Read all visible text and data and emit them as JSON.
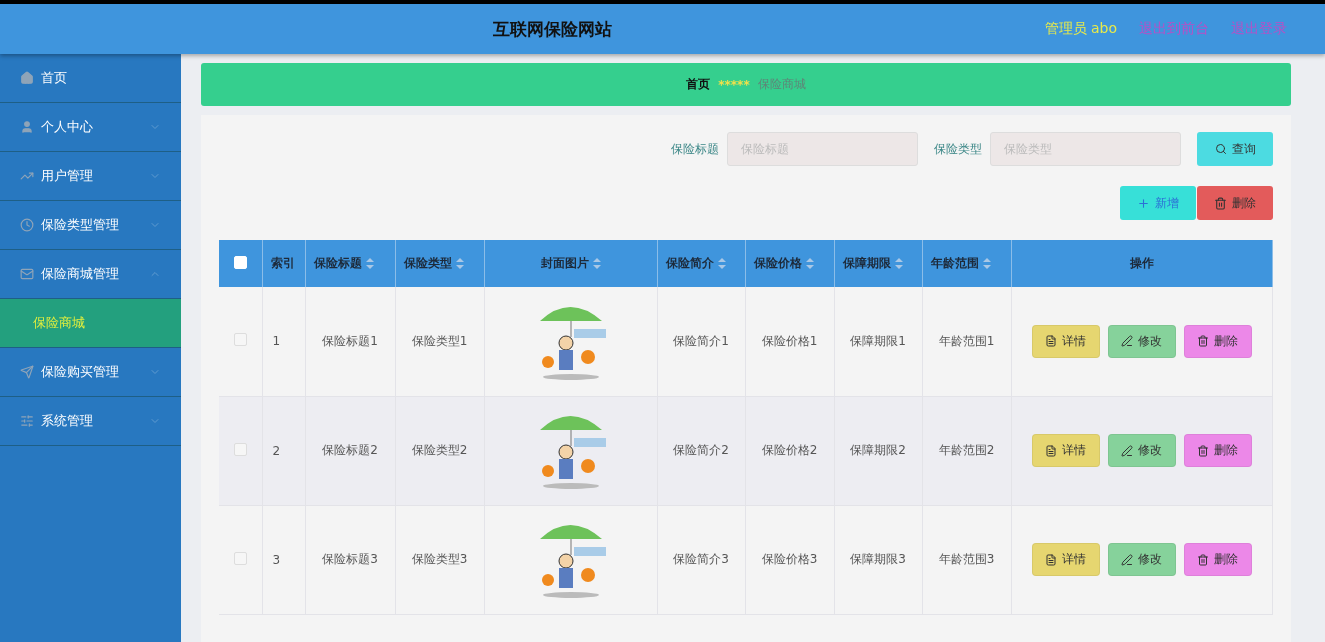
{
  "header": {
    "title": "互联网保险网站",
    "user": "管理员 abo",
    "links": [
      "退出到前台",
      "退出登录"
    ]
  },
  "sidebar": {
    "items": [
      {
        "label": "首页",
        "kind": "link"
      },
      {
        "label": "个人中心",
        "kind": "menu",
        "expanded": false
      },
      {
        "label": "用户管理",
        "kind": "menu",
        "expanded": false
      },
      {
        "label": "保险类型管理",
        "kind": "menu",
        "expanded": false
      },
      {
        "label": "保险商城管理",
        "kind": "menu",
        "expanded": true,
        "children": [
          {
            "label": "保险商城",
            "selected": true
          }
        ]
      },
      {
        "label": "保险购买管理",
        "kind": "menu",
        "expanded": false
      },
      {
        "label": "系统管理",
        "kind": "menu",
        "expanded": false
      }
    ]
  },
  "breadcrumb": {
    "home": "首页",
    "separator": "*****",
    "current": "保险商城"
  },
  "search": {
    "fields": [
      {
        "label": "保险标题",
        "placeholder": "保险标题"
      },
      {
        "label": "保险类型",
        "placeholder": "保险类型"
      }
    ],
    "button": "查询"
  },
  "actions": [
    {
      "label": "新增",
      "kind": "add"
    },
    {
      "label": "删除",
      "kind": "delete"
    }
  ],
  "table": {
    "select_all": {
      "checked": false
    },
    "columns": [
      {
        "label": "索引",
        "sortable": false
      },
      {
        "label": "保险标题",
        "sortable": true
      },
      {
        "label": "保险类型",
        "sortable": true
      },
      {
        "label": "封面图片",
        "sortable": true
      },
      {
        "label": "保险简介",
        "sortable": true
      },
      {
        "label": "保险价格",
        "sortable": true
      },
      {
        "label": "保障期限",
        "sortable": true
      },
      {
        "label": "年龄范围",
        "sortable": true
      },
      {
        "label": "操作",
        "sortable": false
      }
    ],
    "rows": [
      {
        "checked": false,
        "cells": [
          "1",
          "保险标题1",
          "保险类型1",
          "",
          "保险简介1",
          "保险价格1",
          "保障期限1",
          "年龄范围1"
        ],
        "buttons": [
          {
            "label": "详情",
            "kind": "detail"
          },
          {
            "label": "修改",
            "kind": "edit"
          },
          {
            "label": "删除",
            "kind": "delete"
          }
        ]
      },
      {
        "checked": false,
        "cells": [
          "2",
          "保险标题2",
          "保险类型2",
          "",
          "保险简介2",
          "保险价格2",
          "保障期限2",
          "年龄范围2"
        ],
        "buttons": [
          {
            "label": "详情",
            "kind": "detail"
          },
          {
            "label": "修改",
            "kind": "edit"
          },
          {
            "label": "删除",
            "kind": "delete"
          }
        ]
      },
      {
        "checked": false,
        "cells": [
          "3",
          "保险标题3",
          "保险类型3",
          "",
          "保险简介3",
          "保险价格3",
          "保障期限3",
          "年龄范围3"
        ],
        "buttons": [
          {
            "label": "详情",
            "kind": "detail"
          },
          {
            "label": "修改",
            "kind": "edit"
          },
          {
            "label": "删除",
            "kind": "delete"
          }
        ]
      }
    ]
  }
}
